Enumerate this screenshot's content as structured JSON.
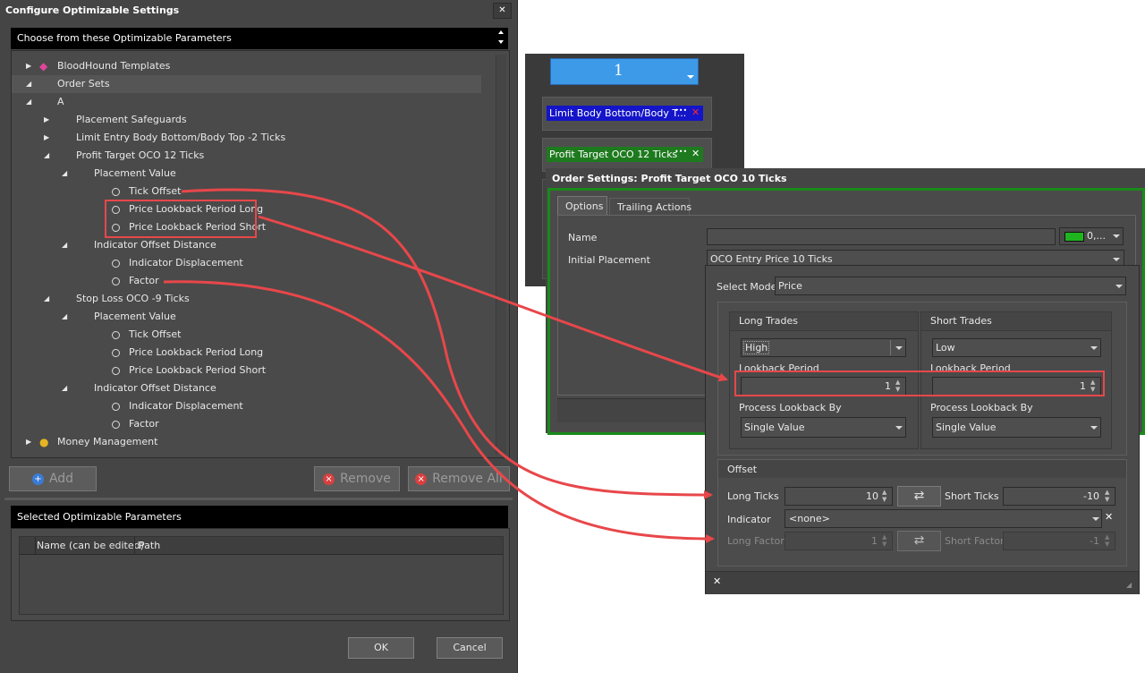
{
  "dialog": {
    "title": "Configure Optimizable Settings",
    "close": "✕",
    "choose_header": "Choose from these Optimizable Parameters",
    "tree": [
      {
        "level": 0,
        "expander": "collapsed",
        "icon": "templates",
        "label": "BloodHound Templates"
      },
      {
        "level": 0,
        "expander": "expanded",
        "icon": "",
        "label": "Order Sets"
      },
      {
        "level": 1,
        "expander": "expanded",
        "icon": "",
        "label": "A"
      },
      {
        "level": 2,
        "expander": "collapsed",
        "icon": "",
        "label": "Placement Safeguards"
      },
      {
        "level": 2,
        "expander": "collapsed",
        "icon": "",
        "label": "Limit Entry Body Bottom/Body Top -2 Ticks"
      },
      {
        "level": 2,
        "expander": "expanded",
        "icon": "",
        "label": "Profit Target OCO  12 Ticks"
      },
      {
        "level": 3,
        "expander": "expanded",
        "icon": "",
        "label": "Placement Value"
      },
      {
        "level": 4,
        "expander": "radio",
        "icon": "",
        "label": "Tick Offset"
      },
      {
        "level": 4,
        "expander": "radio",
        "icon": "",
        "label": "Price Lookback Period Long"
      },
      {
        "level": 4,
        "expander": "radio",
        "icon": "",
        "label": "Price Lookback Period Short"
      },
      {
        "level": 3,
        "expander": "expanded",
        "icon": "",
        "label": "Indicator Offset Distance"
      },
      {
        "level": 4,
        "expander": "radio",
        "icon": "",
        "label": "Indicator Displacement"
      },
      {
        "level": 4,
        "expander": "radio",
        "icon": "",
        "label": "Factor"
      },
      {
        "level": 2,
        "expander": "expanded",
        "icon": "",
        "label": "Stop Loss OCO  -9 Ticks"
      },
      {
        "level": 3,
        "expander": "expanded",
        "icon": "",
        "label": "Placement Value"
      },
      {
        "level": 4,
        "expander": "radio",
        "icon": "",
        "label": "Tick Offset"
      },
      {
        "level": 4,
        "expander": "radio",
        "icon": "",
        "label": "Price Lookback Period Long"
      },
      {
        "level": 4,
        "expander": "radio",
        "icon": "",
        "label": "Price Lookback Period Short"
      },
      {
        "level": 3,
        "expander": "expanded",
        "icon": "",
        "label": "Indicator Offset Distance"
      },
      {
        "level": 4,
        "expander": "radio",
        "icon": "",
        "label": "Indicator Displacement"
      },
      {
        "level": 4,
        "expander": "radio",
        "icon": "",
        "label": "Factor"
      },
      {
        "level": 0,
        "expander": "collapsed",
        "icon": "money",
        "label": "Money Management"
      }
    ],
    "add_label": "Add",
    "remove_label": "Remove",
    "remove_all_label": "Remove All",
    "selected_header": "Selected Optimizable Parameters",
    "grid_columns": [
      "Name (can be edited)",
      "Path"
    ],
    "ok_label": "OK",
    "cancel_label": "Cancel"
  },
  "background_panel": {
    "number": "1",
    "limit_label": "Limit  Body Bottom/Body T...",
    "limit_dots": "•••",
    "limit_close": "✕",
    "profit_label": "Profit Target OCO  12 Ticks",
    "profit_dots": "•••",
    "profit_close": "✕"
  },
  "order_settings": {
    "title": "Order Settings: Profit Target OCO  10 Ticks",
    "tabs": [
      "Options",
      "Trailing Actions"
    ],
    "name_label": "Name",
    "name_value": "",
    "color_value": "0,...",
    "initial_placement_label": "Initial Placement",
    "initial_placement_value": "OCO Entry Price 10 Ticks"
  },
  "placement_popup": {
    "select_mode_label": "Select Mode",
    "select_mode_value": "Price",
    "long": {
      "header": "Long Trades",
      "value": "High",
      "lookback_label": "Lookback Period",
      "lookback_value": "1",
      "process_label": "Process Lookback By",
      "process_value": "Single Value"
    },
    "short": {
      "header": "Short Trades",
      "value": "Low",
      "lookback_label": "Lookback Period",
      "lookback_value": "1",
      "process_label": "Process Lookback By",
      "process_value": "Single Value"
    },
    "offset": {
      "header": "Offset",
      "long_ticks_label": "Long Ticks",
      "long_ticks_value": "10",
      "short_ticks_label": "Short Ticks",
      "short_ticks_value": "-10",
      "indicator_label": "Indicator",
      "indicator_value": "<none>",
      "indicator_clear": "✕",
      "long_factor_label": "Long Factor",
      "long_factor_value": "1",
      "short_factor_label": "Short Factor",
      "short_factor_value": "-1"
    },
    "close": "✕"
  },
  "colors": {
    "accent_red": "#e8474a",
    "limit_blue": "#1414c8",
    "profit_green": "#1e7a1e",
    "order_border_green": "#1a8a1a"
  }
}
